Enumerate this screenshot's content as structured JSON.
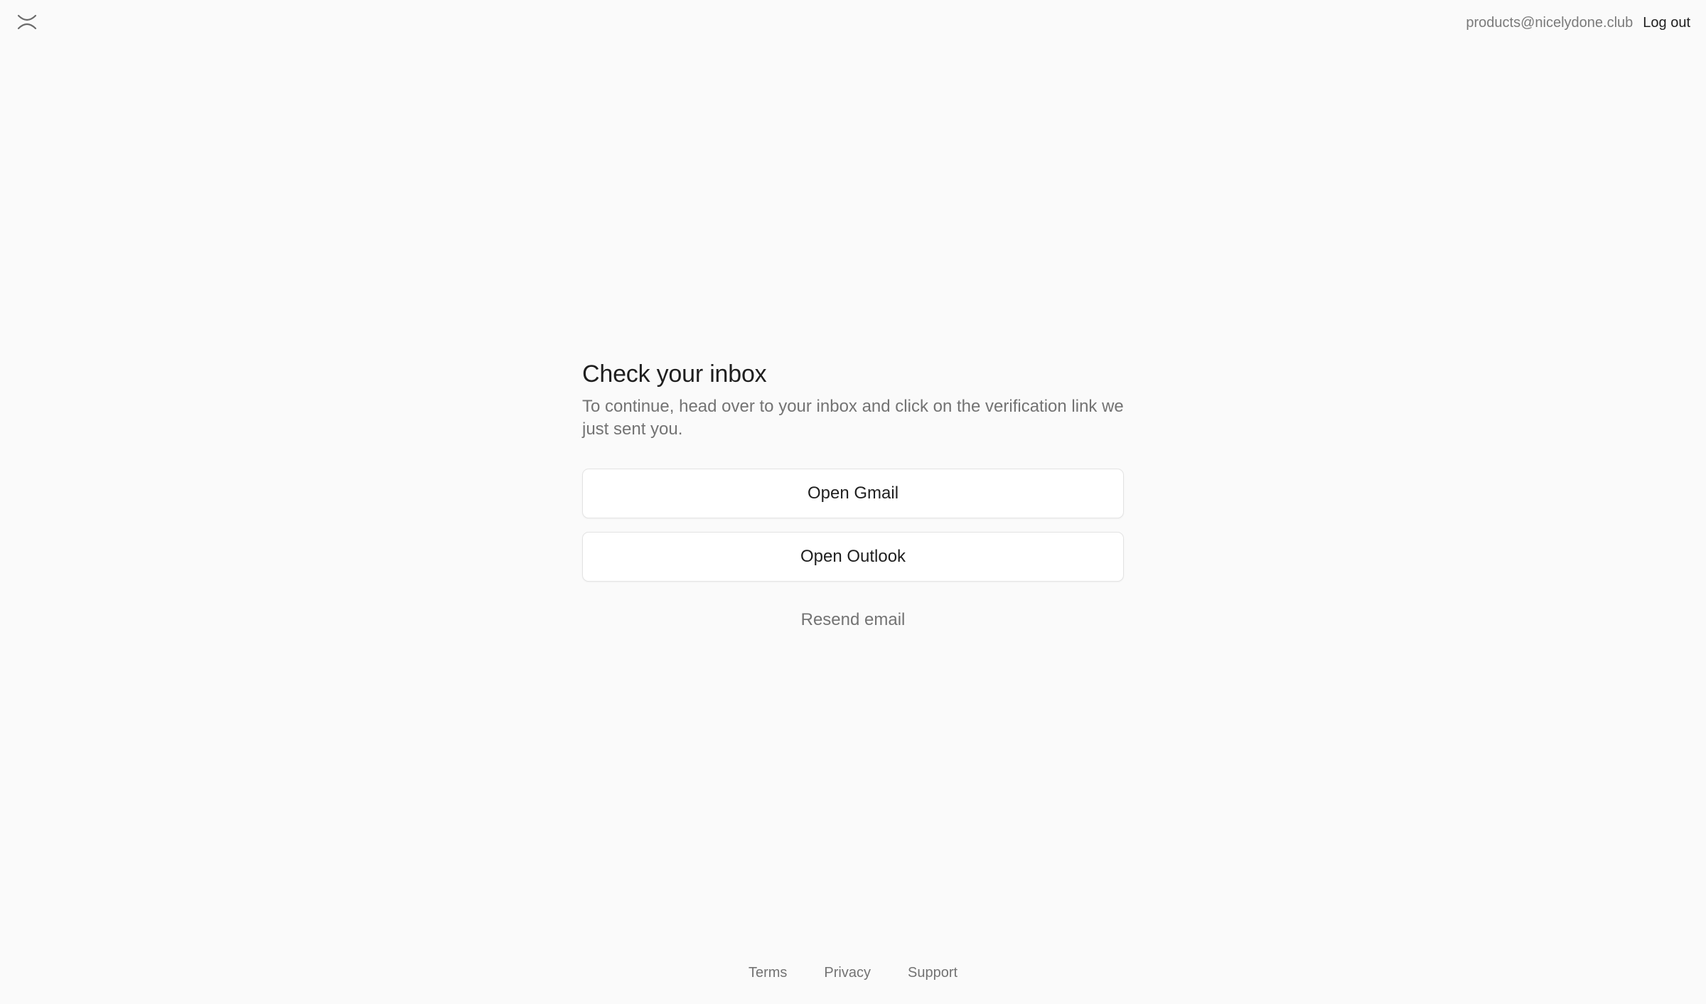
{
  "header": {
    "logo_icon": "close-x-icon",
    "account_email": "products@nicelydone.club",
    "logout_label": "Log out"
  },
  "main": {
    "title": "Check your inbox",
    "subtitle": "To continue, head over to your inbox and click on the verification link we just sent you.",
    "buttons": [
      {
        "label": "Open Gmail"
      },
      {
        "label": "Open Outlook"
      }
    ],
    "resend_label": "Resend email"
  },
  "footer": {
    "links": [
      "Terms",
      "Privacy",
      "Support"
    ]
  },
  "colors": {
    "background": "#fafafa",
    "text_primary": "#1f1f1f",
    "text_secondary": "#737373",
    "button_background": "#ffffff",
    "button_border": "#e3e3e3"
  }
}
